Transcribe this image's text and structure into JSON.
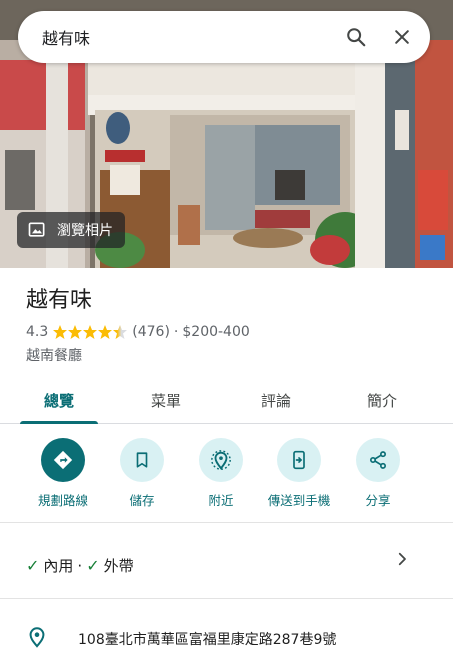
{
  "search": {
    "query": "越有味",
    "search_icon": "search-icon",
    "close_icon": "close-icon"
  },
  "hero": {
    "photos_label": "瀏覽相片",
    "photos_icon": "photo-library-icon"
  },
  "place": {
    "name": "越有味",
    "rating": "4.3",
    "stars_filled": 4.3,
    "review_count": "(476)",
    "separator": "·",
    "price": "$200-400",
    "category": "越南餐廳"
  },
  "tabs": [
    {
      "label": "總覽",
      "active": true
    },
    {
      "label": "菜單",
      "active": false
    },
    {
      "label": "評論",
      "active": false
    },
    {
      "label": "簡介",
      "active": false
    }
  ],
  "actions": [
    {
      "label": "規劃路線",
      "icon": "directions-icon"
    },
    {
      "label": "儲存",
      "icon": "bookmark-icon"
    },
    {
      "label": "附近",
      "icon": "nearby-icon"
    },
    {
      "label": "傳送到手機",
      "icon": "send-to-phone-icon"
    },
    {
      "label": "分享",
      "icon": "share-icon"
    }
  ],
  "service": {
    "option1": "內用",
    "separator": "·",
    "option2": "外帶",
    "check_icon": "check-icon"
  },
  "address": {
    "text": "108臺北市萬華區富福里康定路287巷9號",
    "icon": "location-pin-icon"
  },
  "colors": {
    "accent": "#0b6e75",
    "accent_light": "#d9f1f3",
    "star": "#fbbc04"
  }
}
